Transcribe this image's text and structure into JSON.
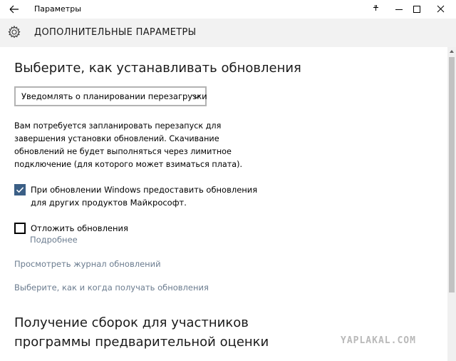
{
  "window": {
    "title": "Параметры"
  },
  "header": {
    "title": "ДОПОЛНИТЕЛЬНЫЕ ПАРАМЕТРЫ"
  },
  "install": {
    "heading": "Выберите, как устанавливать обновления",
    "dropdown_value": "Уведомлять о планировании перезагрузки",
    "description": "Вам потребуется запланировать перезапуск для завершения установки обновлений. Скачивание обновлений не будет выполняться через лимитное подключение (для которого может взиматься плата)."
  },
  "options": {
    "other_products": {
      "label": "При обновлении Windows предоставить обновления для других продуктов Майкрософт.",
      "checked": true
    },
    "defer": {
      "label": "Отложить обновления",
      "checked": false,
      "more_link": "Подробнее"
    }
  },
  "links": {
    "history": "Просмотреть журнал обновлений",
    "delivery": "Выберите, как и когда получать обновления"
  },
  "insider": {
    "heading_line1": "Получение сборок для участников",
    "heading_line2": "программы предварительной оценки"
  },
  "watermark": "YAPLAKAL.COM",
  "colors": {
    "header_bg": "#f2f2f2",
    "checkbox_accent": "#3b5f86",
    "link": "#6b7c8f"
  },
  "icons": {
    "back": "arrow-left-icon",
    "settings": "gear-icon",
    "dropdown": "chevron-down-icon",
    "check": "checkmark-icon"
  }
}
